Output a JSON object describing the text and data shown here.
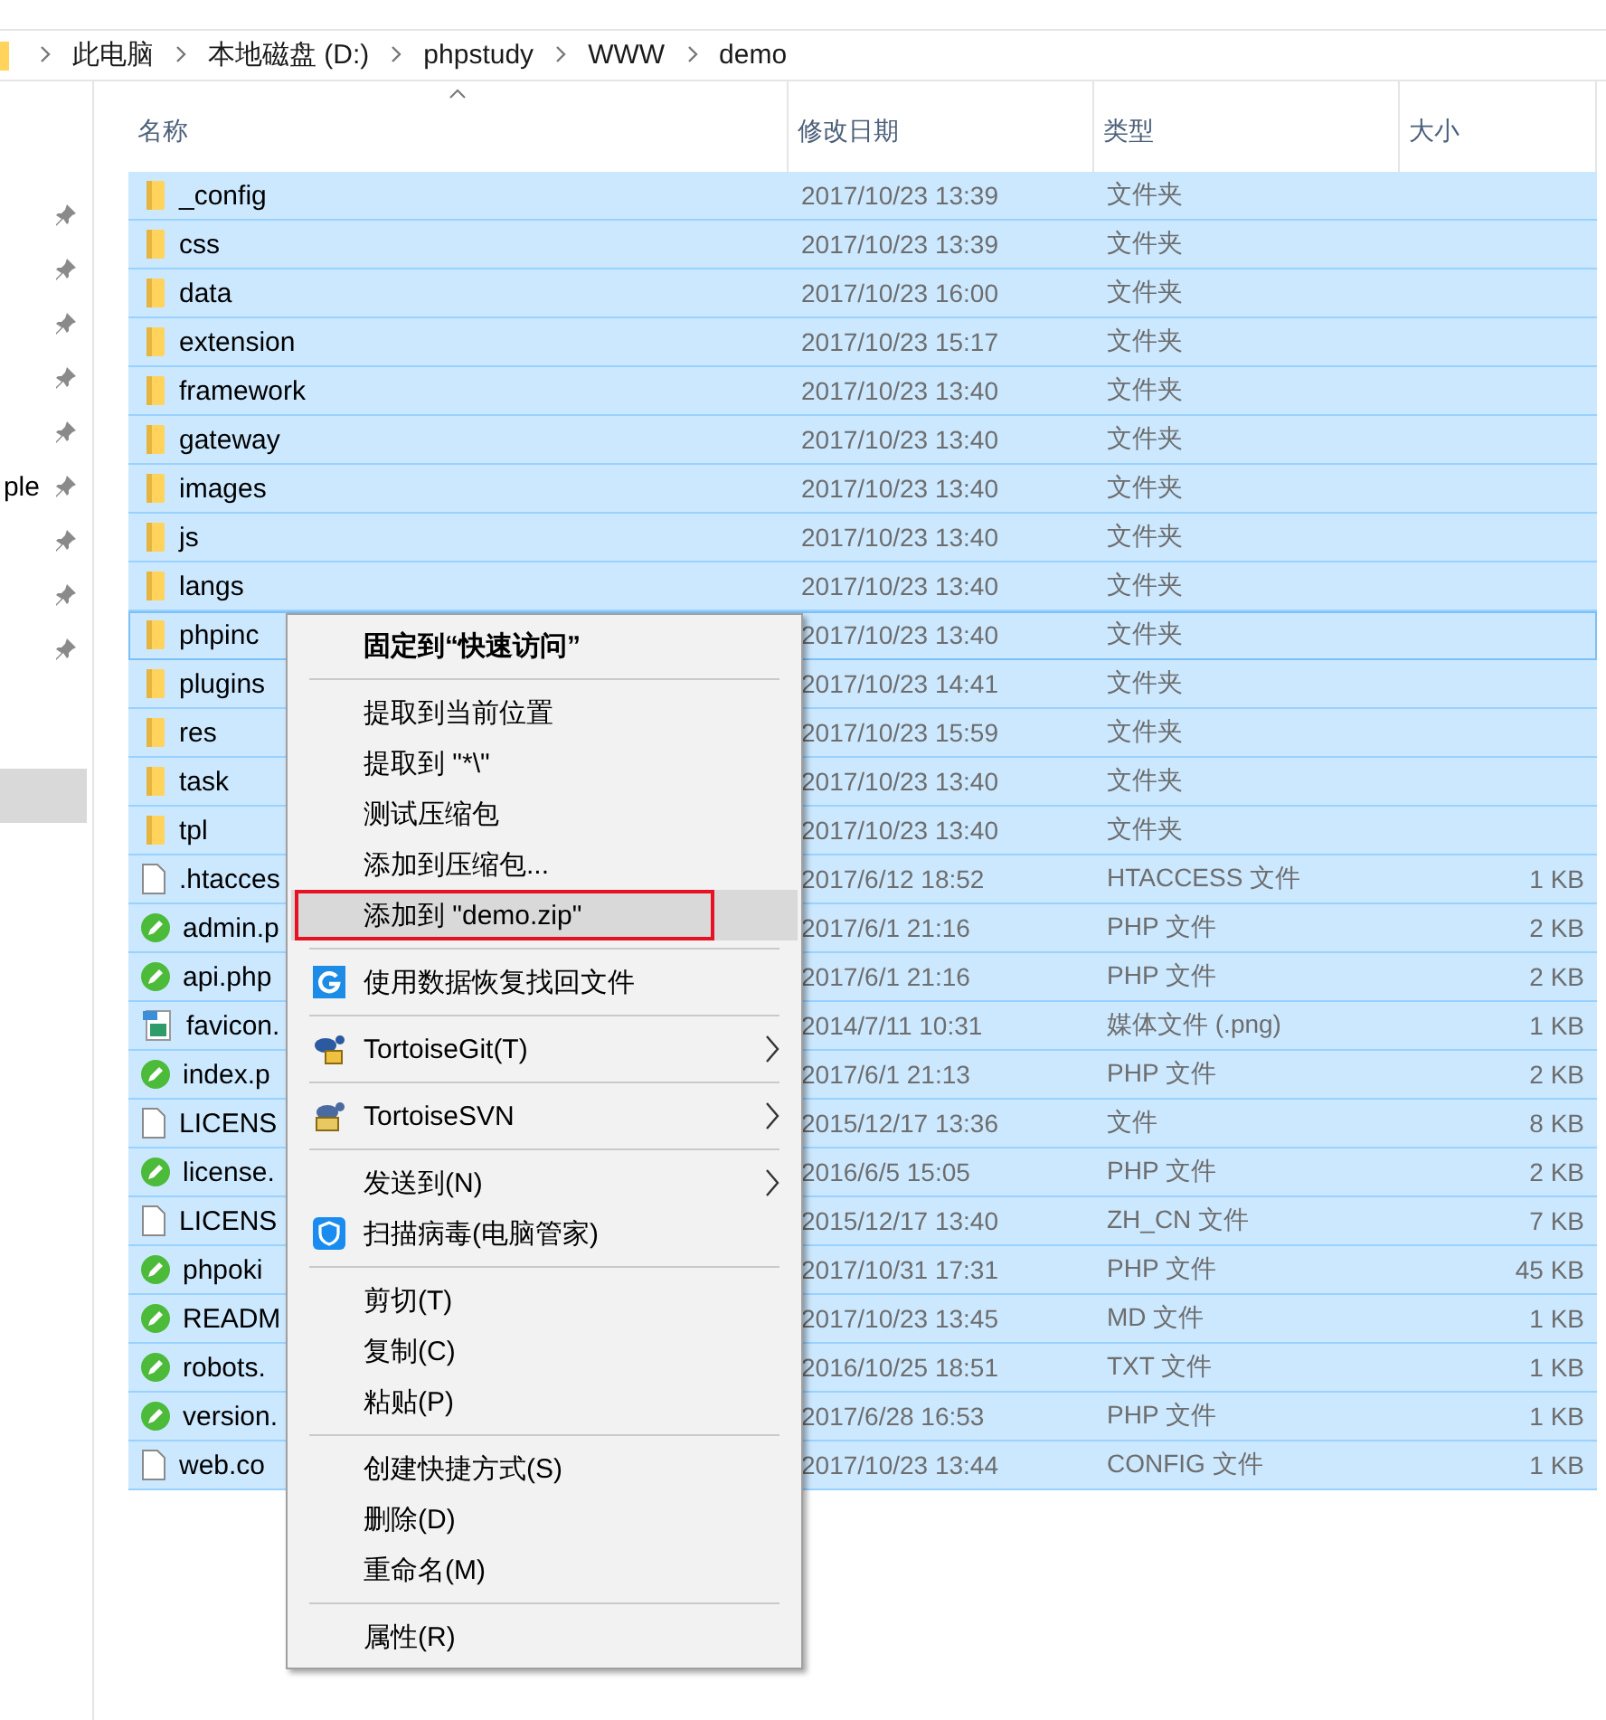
{
  "breadcrumb": [
    "此电脑",
    "本地磁盘 (D:)",
    "phpstudy",
    "WWW",
    "demo"
  ],
  "sidebar": {
    "items": [
      {
        "pinned": true,
        "selected": false
      },
      {
        "pinned": true,
        "selected": false
      },
      {
        "pinned": true,
        "selected": false
      },
      {
        "pinned": true,
        "selected": false
      },
      {
        "pinned": true,
        "selected": false
      },
      {
        "pinned": true,
        "selected": false,
        "label": "ple"
      },
      {
        "pinned": true,
        "selected": false
      },
      {
        "pinned": true,
        "selected": false
      },
      {
        "pinned": true,
        "selected": false
      },
      {
        "pinned": false,
        "selected": true
      }
    ]
  },
  "columns": [
    {
      "label": "名称",
      "sorted": true
    },
    {
      "label": "修改日期",
      "sorted": false
    },
    {
      "label": "类型",
      "sorted": false
    },
    {
      "label": "大小",
      "sorted": false
    }
  ],
  "files": [
    {
      "kind": "folder",
      "name": "_config",
      "date": "2017/10/23 13:39",
      "type": "文件夹",
      "selected": true,
      "focused": false
    },
    {
      "kind": "folder",
      "name": "css",
      "date": "2017/10/23 13:39",
      "type": "文件夹",
      "selected": true,
      "focused": false
    },
    {
      "kind": "folder",
      "name": "data",
      "date": "2017/10/23 16:00",
      "type": "文件夹",
      "selected": true,
      "focused": false
    },
    {
      "kind": "folder",
      "name": "extension",
      "date": "2017/10/23 15:17",
      "type": "文件夹",
      "selected": true,
      "focused": false
    },
    {
      "kind": "folder",
      "name": "framework",
      "date": "2017/10/23 13:40",
      "type": "文件夹",
      "selected": true,
      "focused": false
    },
    {
      "kind": "folder",
      "name": "gateway",
      "date": "2017/10/23 13:40",
      "type": "文件夹",
      "selected": true,
      "focused": false
    },
    {
      "kind": "folder",
      "name": "images",
      "date": "2017/10/23 13:40",
      "type": "文件夹",
      "selected": true,
      "focused": false
    },
    {
      "kind": "folder",
      "name": "js",
      "date": "2017/10/23 13:40",
      "type": "文件夹",
      "selected": true,
      "focused": false
    },
    {
      "kind": "folder",
      "name": "langs",
      "date": "2017/10/23 13:40",
      "type": "文件夹",
      "selected": true,
      "focused": false
    },
    {
      "kind": "folder",
      "name": "phpinc",
      "date": "2017/10/23 13:40",
      "type": "文件夹",
      "selected": true,
      "focused": true
    },
    {
      "kind": "folder",
      "name": "plugins",
      "date": "2017/10/23 14:41",
      "type": "文件夹",
      "selected": true,
      "focused": false
    },
    {
      "kind": "folder",
      "name": "res",
      "date": "2017/10/23 15:59",
      "type": "文件夹",
      "selected": true,
      "focused": false
    },
    {
      "kind": "folder",
      "name": "task",
      "date": "2017/10/23 13:40",
      "type": "文件夹",
      "selected": true,
      "focused": false
    },
    {
      "kind": "folder",
      "name": "tpl",
      "date": "2017/10/23 13:40",
      "type": "文件夹",
      "selected": true,
      "focused": false
    },
    {
      "kind": "file",
      "name": ".htacces",
      "date": "2017/6/12 18:52",
      "type": "HTACCESS 文件",
      "size": "1 KB",
      "selected": true,
      "focused": false
    },
    {
      "kind": "php",
      "name": "admin.p",
      "date": "2017/6/1 21:16",
      "type": "PHP 文件",
      "size": "2 KB",
      "selected": true,
      "focused": false
    },
    {
      "kind": "php",
      "name": "api.php",
      "date": "2017/6/1 21:16",
      "type": "PHP 文件",
      "size": "2 KB",
      "selected": true,
      "focused": false
    },
    {
      "kind": "image",
      "name": "favicon.",
      "date": "2014/7/11 10:31",
      "type": "媒体文件 (.png)",
      "size": "1 KB",
      "selected": true,
      "focused": false
    },
    {
      "kind": "php",
      "name": "index.p",
      "date": "2017/6/1 21:13",
      "type": "PHP 文件",
      "size": "2 KB",
      "selected": true,
      "focused": false
    },
    {
      "kind": "file",
      "name": "LICENS",
      "date": "2015/12/17 13:36",
      "type": "文件",
      "size": "8 KB",
      "selected": true,
      "focused": false
    },
    {
      "kind": "php",
      "name": "license.",
      "date": "2016/6/5 15:05",
      "type": "PHP 文件",
      "size": "2 KB",
      "selected": true,
      "focused": false
    },
    {
      "kind": "file",
      "name": "LICENS",
      "date": "2015/12/17 13:40",
      "type": "ZH_CN 文件",
      "size": "7 KB",
      "selected": true,
      "focused": false
    },
    {
      "kind": "php",
      "name": "phpoki",
      "date": "2017/10/31 17:31",
      "type": "PHP 文件",
      "size": "45 KB",
      "selected": true,
      "focused": false
    },
    {
      "kind": "php",
      "name": "READM",
      "date": "2017/10/23 13:45",
      "type": "MD 文件",
      "size": "1 KB",
      "selected": true,
      "focused": false
    },
    {
      "kind": "php",
      "name": "robots.",
      "date": "2016/10/25 18:51",
      "type": "TXT 文件",
      "size": "1 KB",
      "selected": true,
      "focused": false
    },
    {
      "kind": "php",
      "name": "version.",
      "date": "2017/6/28 16:53",
      "type": "PHP 文件",
      "size": "1 KB",
      "selected": true,
      "focused": false
    },
    {
      "kind": "file",
      "name": "web.co",
      "date": "2017/10/23 13:44",
      "type": "CONFIG 文件",
      "size": "1 KB",
      "selected": true,
      "focused": false
    }
  ],
  "context_menu": [
    {
      "kind": "item",
      "label": "固定到“快速访问”",
      "bold": true
    },
    {
      "kind": "separator"
    },
    {
      "kind": "item",
      "label": "提取到当前位置"
    },
    {
      "kind": "item",
      "label": "提取到 \"*\\\""
    },
    {
      "kind": "item",
      "label": "测试压缩包"
    },
    {
      "kind": "item",
      "label": "添加到压缩包..."
    },
    {
      "kind": "item",
      "label": "添加到 \"demo.zip\"",
      "hovered": true,
      "annotated": true
    },
    {
      "kind": "separator"
    },
    {
      "kind": "recovery",
      "label": "使用数据恢复找回文件"
    },
    {
      "kind": "separator"
    },
    {
      "kind": "git",
      "label": "TortoiseGit(T)",
      "submenu": true
    },
    {
      "kind": "separator"
    },
    {
      "kind": "svn",
      "label": "TortoiseSVN",
      "submenu": true
    },
    {
      "kind": "separator"
    },
    {
      "kind": "item",
      "label": "发送到(N)",
      "submenu": true
    },
    {
      "kind": "shield",
      "label": "扫描病毒(电脑管家)"
    },
    {
      "kind": "separator"
    },
    {
      "kind": "item",
      "label": "剪切(T)"
    },
    {
      "kind": "item",
      "label": "复制(C)"
    },
    {
      "kind": "item",
      "label": "粘贴(P)"
    },
    {
      "kind": "separator"
    },
    {
      "kind": "item",
      "label": "创建快捷方式(S)"
    },
    {
      "kind": "item",
      "label": "删除(D)"
    },
    {
      "kind": "item",
      "label": "重命名(M)"
    },
    {
      "kind": "separator"
    },
    {
      "kind": "item",
      "label": "属性(R)"
    }
  ]
}
